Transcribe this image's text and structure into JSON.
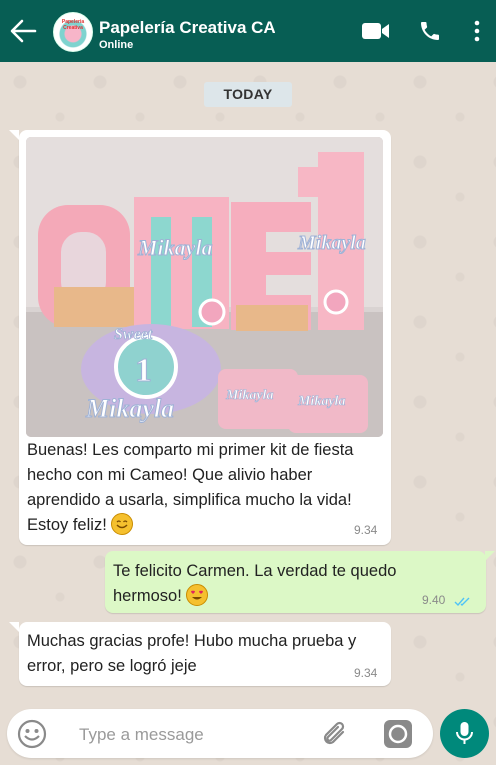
{
  "header": {
    "title": "Papelería Creativa CA",
    "status": "Online",
    "avatar_text": "Papeleria Creativa"
  },
  "chat": {
    "date_label": "TODAY",
    "messages": [
      {
        "direction": "incoming",
        "has_image": true,
        "image_alt": "Party kit with ONE letters, Mikayla toppers and Sweet 1 cake topper",
        "text": "Buenas! Les comparto mi primer kit de fiesta hecho con mi Cameo! Que alivio haber aprendido a usarla, simplifica mucho la vida! Estoy feliz!",
        "emoji": "smiling-face-icon",
        "time": "9.34"
      },
      {
        "direction": "outgoing",
        "text": "Te felicito Carmen. La verdad te quedo hermoso!",
        "emoji": "heart-eyes-icon",
        "time": "9.40",
        "read": true
      },
      {
        "direction": "incoming",
        "text": "Muchas gracias profe! Hubo mucha prueba y error, pero se logró jeje",
        "time": "9.34"
      }
    ]
  },
  "composer": {
    "placeholder": "Type a message"
  },
  "colors": {
    "header": "#075e54",
    "incoming": "#ffffff",
    "outgoing": "#dcf8c6",
    "accent": "#00897b",
    "read_tick": "#4fc3f7"
  }
}
